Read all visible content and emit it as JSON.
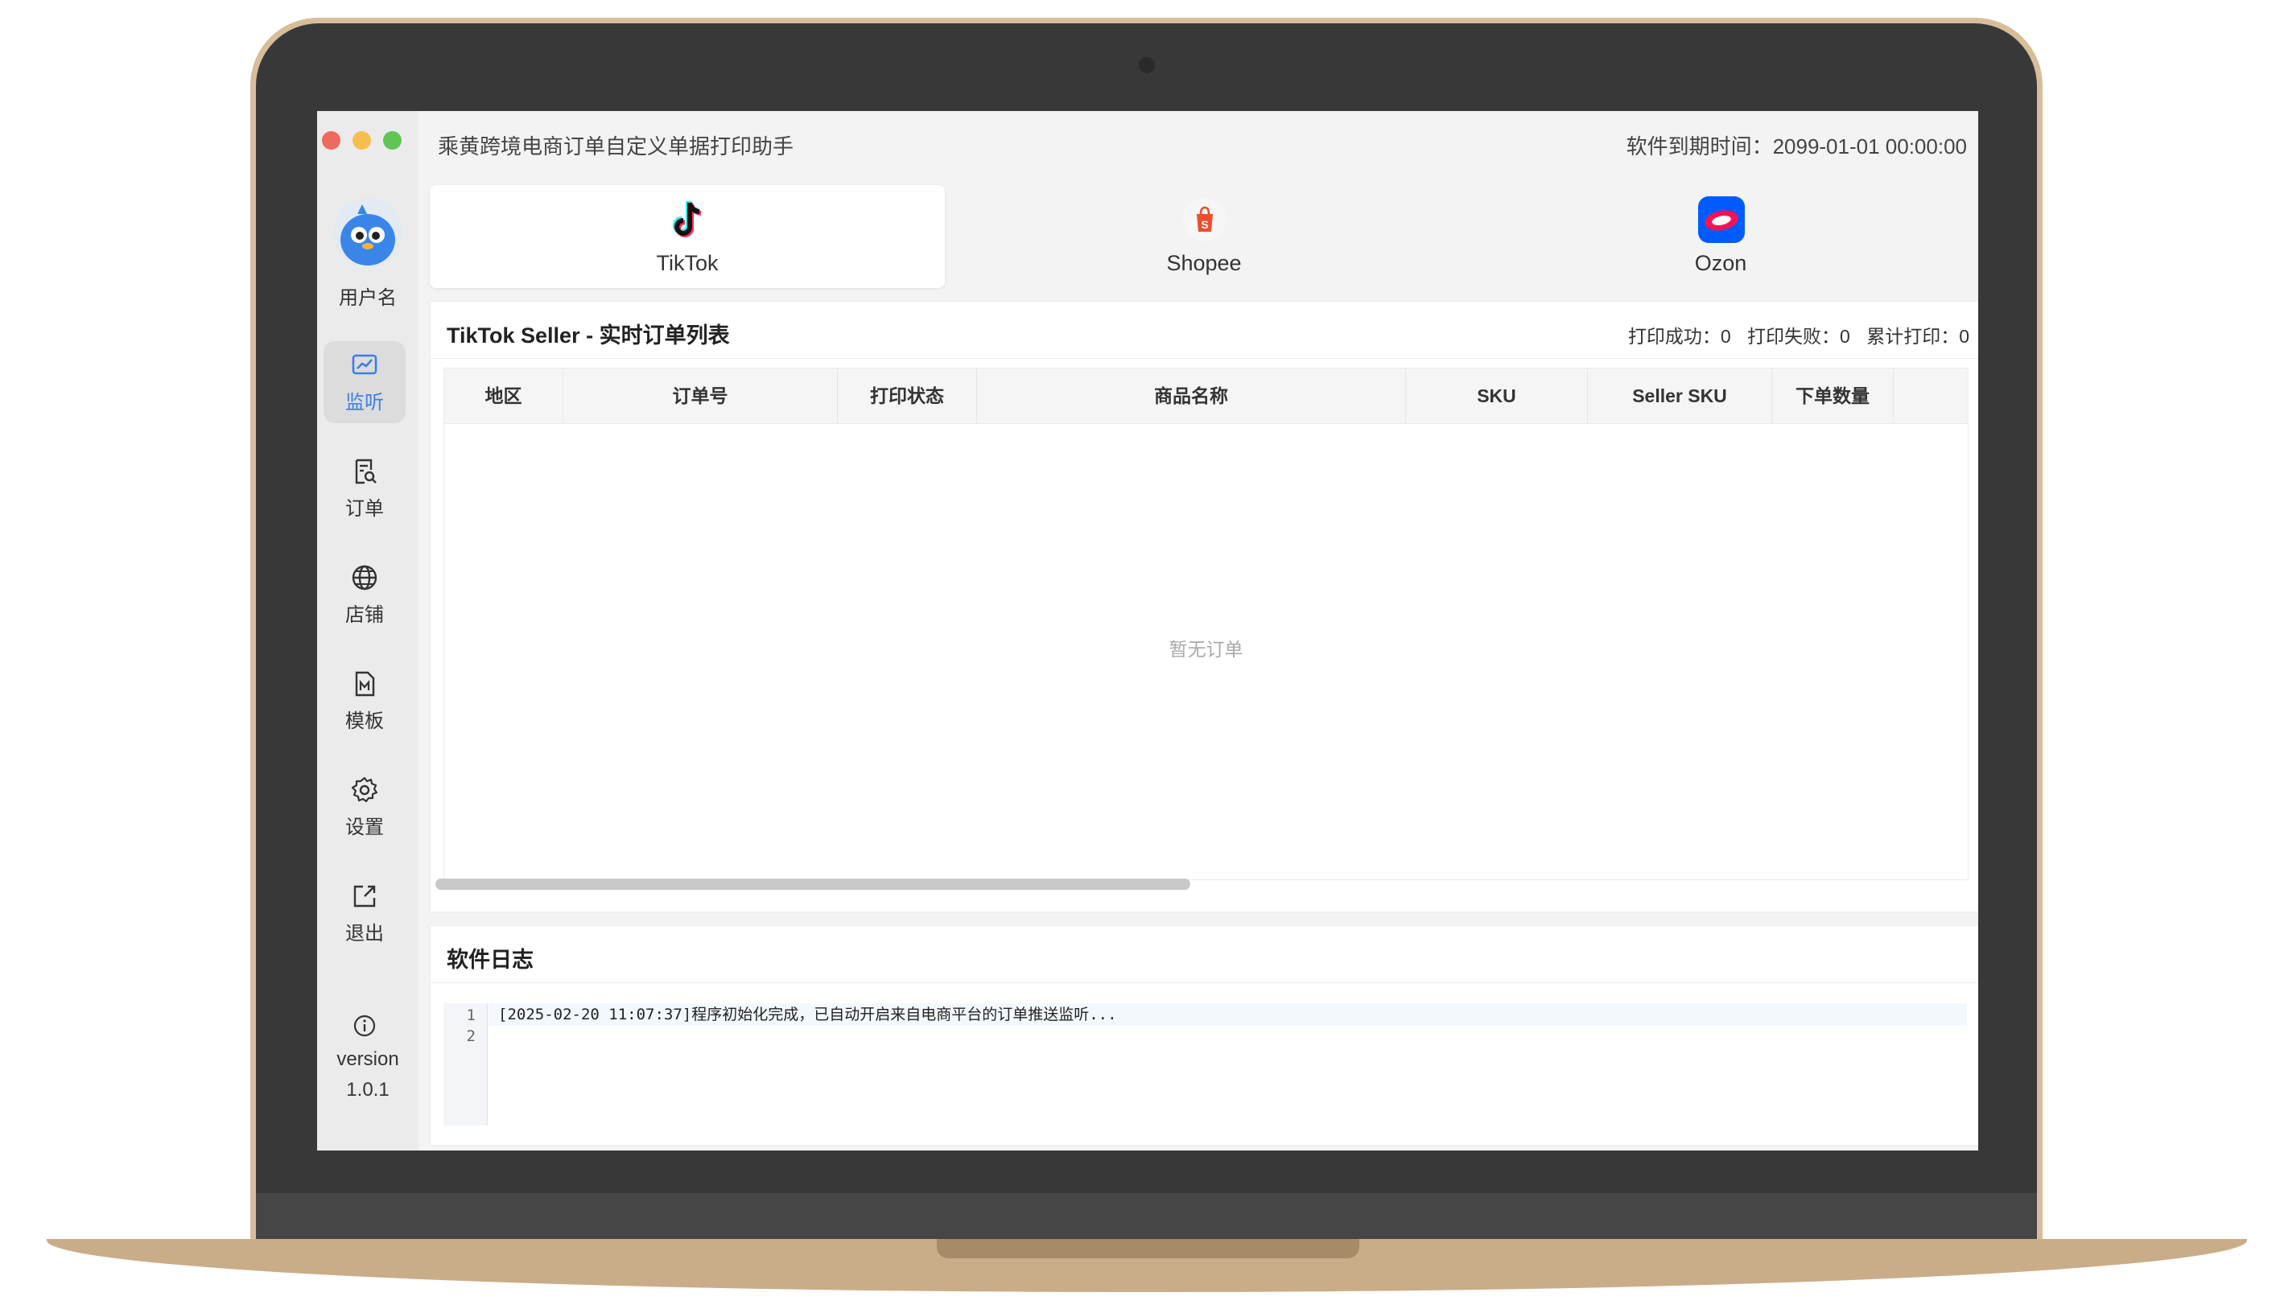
{
  "app": {
    "title": "乘黄跨境电商订单自定义单据打印助手",
    "expiry": "软件到期时间：2099-01-01 00:00:00"
  },
  "user": {
    "name": "用户名"
  },
  "sidebar": {
    "items": [
      {
        "label": "监听",
        "icon": "monitor-chart-icon",
        "active": true
      },
      {
        "label": "订单",
        "icon": "order-search-icon"
      },
      {
        "label": "店铺",
        "icon": "globe-icon"
      },
      {
        "label": "模板",
        "icon": "template-file-icon"
      },
      {
        "label": "设置",
        "icon": "gear-icon"
      },
      {
        "label": "退出",
        "icon": "logout-icon"
      }
    ],
    "version_label": "version",
    "version_number": "1.0.1"
  },
  "platforms": [
    {
      "label": "TikTok",
      "icon": "tiktok-logo",
      "active": true
    },
    {
      "label": "Shopee",
      "icon": "shopee-logo"
    },
    {
      "label": "Ozon",
      "icon": "ozon-logo"
    }
  ],
  "orders": {
    "title": "TikTok Seller - 实时订单列表",
    "stats": {
      "success": "打印成功：0",
      "failed": "打印失败：0",
      "total": "累计打印：0"
    },
    "columns": [
      "地区",
      "订单号",
      "打印状态",
      "商品名称",
      "SKU",
      "Seller SKU",
      "下单数量"
    ],
    "empty_text": "暂无订单"
  },
  "logs": {
    "title": "软件日志",
    "line_numbers": [
      "1",
      "2"
    ],
    "lines": [
      "[2025-02-20 11:07:37]程序初始化完成，已自动开启来自电商平台的订单推送监听..."
    ]
  },
  "colors": {
    "accent": "#3d7de8",
    "tiktok_red": "#fe2c55",
    "tiktok_cyan": "#25f4ee",
    "shopee_orange": "#ee4d2d",
    "ozon_blue": "#005bff"
  }
}
